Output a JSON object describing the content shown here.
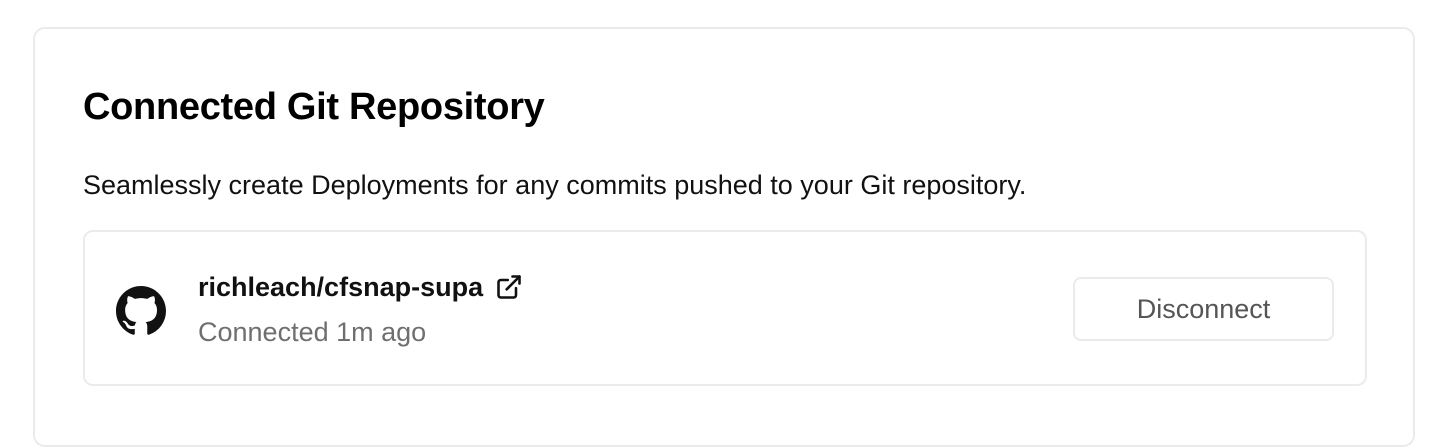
{
  "section": {
    "title": "Connected Git Repository",
    "description": "Seamlessly create Deployments for any commits pushed to your Git repository."
  },
  "repository": {
    "provider_icon": "github-icon",
    "name": "richleach/cfsnap-supa",
    "link_icon": "external-link-icon",
    "status": "Connected 1m ago",
    "disconnect_label": "Disconnect"
  }
}
